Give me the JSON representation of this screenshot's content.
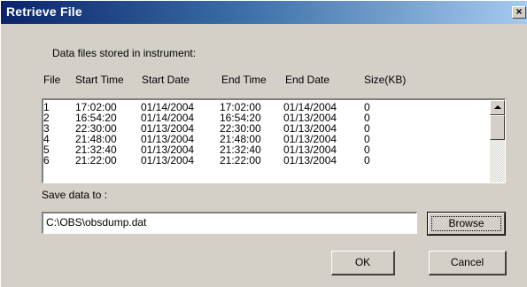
{
  "window": {
    "title": "Retrieve File",
    "close_glyph": "×"
  },
  "section_label": "Data files stored in instrument:",
  "table": {
    "columns": [
      "File",
      "Start Time",
      "Start Date",
      "End Time",
      "End Date",
      "Size(KB)"
    ],
    "rows": [
      [
        "1",
        "17:02:00",
        "01/14/2004",
        "17:02:00",
        "01/14/2004",
        "0"
      ],
      [
        "2",
        "16:54:20",
        "01/14/2004",
        "16:54:20",
        "01/13/2004",
        "0"
      ],
      [
        "3",
        "22:30:00",
        "01/13/2004",
        "22:30:00",
        "01/13/2004",
        "0"
      ],
      [
        "4",
        "21:48:00",
        "01/13/2004",
        "21:48:00",
        "01/13/2004",
        "0"
      ],
      [
        "5",
        "21:32:40",
        "01/13/2004",
        "21:32:40",
        "01/13/2004",
        "0"
      ],
      [
        "6",
        "21:22:00",
        "01/13/2004",
        "21:22:00",
        "01/13/2004",
        "0"
      ]
    ]
  },
  "save_label": "Save data to :",
  "save_path": "C:\\OBS\\obsdump.dat",
  "buttons": {
    "browse": "Browse",
    "ok": "OK",
    "cancel": "Cancel"
  },
  "icons": {
    "close": "close-icon",
    "scroll_up": "arrow-up-icon"
  },
  "colors": {
    "title_gradient_start": "#0a246a",
    "title_gradient_end": "#a6caf0",
    "face": "#d4d0c8"
  }
}
